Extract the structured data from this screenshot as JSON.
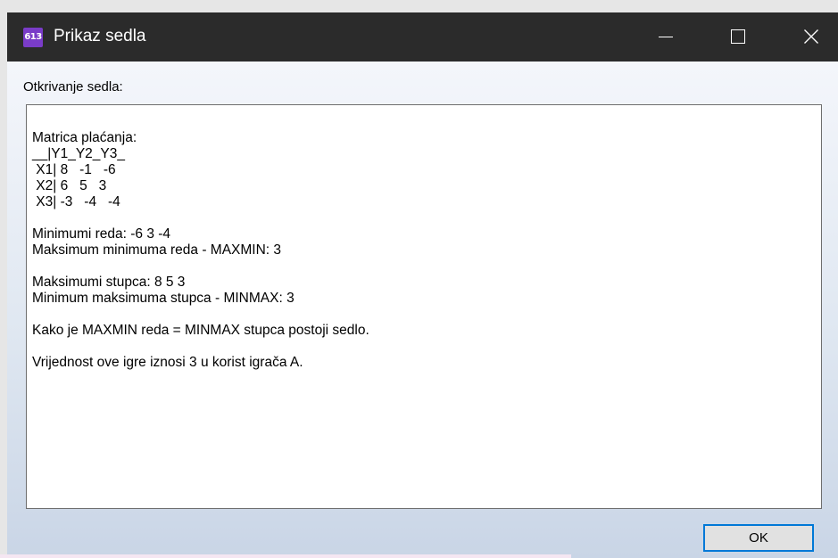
{
  "window": {
    "title": "Prikaz sedla",
    "app_icon_text": "613"
  },
  "titlebar_buttons": {
    "minimize_icon": "minimize-icon",
    "maximize_icon": "maximize-icon",
    "close_icon": "close-icon"
  },
  "content": {
    "section_label": "Otkrivanje sedla:",
    "output_lines": [
      "Matrica plaćanja:",
      "__|Y1_Y2_Y3_",
      " X1| 8   -1   -6",
      " X2| 6   5   3",
      " X3| -3   -4   -4",
      "",
      "Minimumi reda: -6 3 -4",
      "Maksimum minimuma reda - MAXMIN: 3",
      "",
      "Maksimumi stupca: 8 5 3",
      "Minimum maksimuma stupca - MINMAX: 3",
      "",
      "Kako je MAXMIN reda = MINMAX stupca postoji sedlo.",
      "",
      "Vrijednost ove igre iznosi 3 u korist igrača A."
    ]
  },
  "buttons": {
    "ok_label": "OK"
  },
  "colors": {
    "titlebar": "#2b2b2b",
    "app_icon": "#7a3cc8",
    "focus_border": "#0078d7"
  }
}
